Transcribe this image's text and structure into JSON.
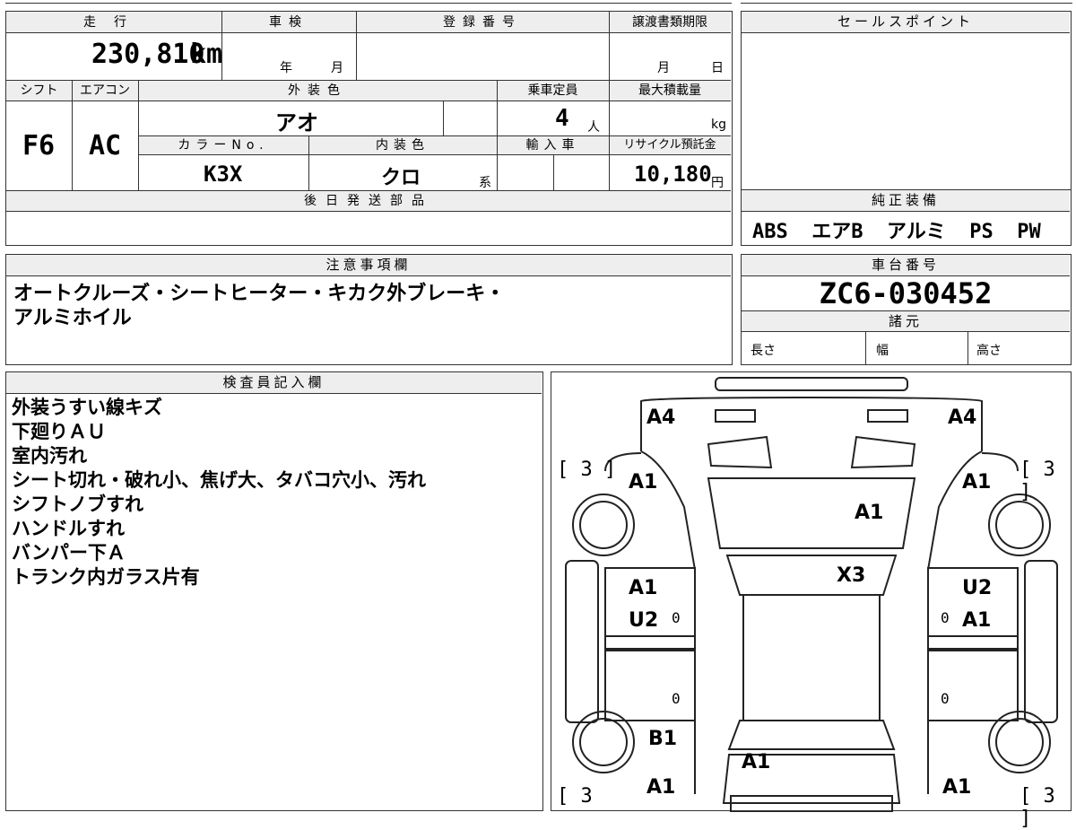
{
  "main": {
    "mileage_label": "走行",
    "mileage_value": "230,810",
    "mileage_unit": "km",
    "shaken_label": "車検",
    "shaken_year": "年",
    "shaken_month": "月",
    "reg_label": "登録番号",
    "transfer_label": "譲渡書類期限",
    "transfer_month": "月",
    "transfer_day": "日",
    "shift_label": "シフト",
    "shift_value": "F6",
    "ac_label": "エアコン",
    "ac_value": "AC",
    "exterior_label": "外装色",
    "exterior_value": "アオ",
    "capacity_label": "乗車定員",
    "capacity_value": "4",
    "capacity_unit": "人",
    "maxload_label": "最大積載量",
    "maxload_unit": "kg",
    "color_no_label": "カラーNo.",
    "color_no_value": "K3X",
    "interior_label": "内装色",
    "interior_value": "クロ",
    "interior_suffix": "系",
    "import_label": "輸入車",
    "recycle_label": "リサイクル預託金",
    "recycle_value": "10,180",
    "recycle_unit": "円",
    "parts_label": "後日発送部品"
  },
  "sales": {
    "label": "セールスポイント"
  },
  "equipment": {
    "label": "純正装備",
    "value": "ABS  エアB  アルミ  PS  PW"
  },
  "caution": {
    "label": "注意事項欄",
    "line1": "オートクルーズ・シートヒーター・キカク外ブレーキ・",
    "line2": "アルミホイル"
  },
  "chassis": {
    "label": "車台番号",
    "value": "ZC6-030452",
    "spec_label": "諸元",
    "length": "長さ",
    "width": "幅",
    "height": "高さ"
  },
  "inspector": {
    "label": "検査員記入欄",
    "lines": [
      "外装うすい線キズ",
      "下廻りＡＵ",
      "室内汚れ",
      "シート切れ・破れ小、焦げ大、タバコ穴小、汚れ",
      "シフトノブすれ",
      "ハンドルすれ",
      "バンパー下Ａ",
      "トランク内ガラス片有"
    ]
  },
  "diagram": {
    "marks": {
      "a4_left": "A4",
      "a4_right": "A4",
      "a1_front_left": "A1",
      "a1_front_right": "A1",
      "a1_hood": "A1",
      "x3": "X3",
      "a1_mid_left": "A1",
      "u2_left": "U2",
      "u2_right": "U2",
      "a1_mid_right": "A1",
      "b1": "B1",
      "a1_trunk": "A1",
      "a1_rear_left": "A1",
      "a1_rear_right": "A1"
    },
    "tyre_tl": "[ 3 ]",
    "tyre_tr": "[ 3 ]",
    "tyre_bl": "[ 3",
    "tyre_br": "[ 3 ]",
    "zero": "0"
  }
}
